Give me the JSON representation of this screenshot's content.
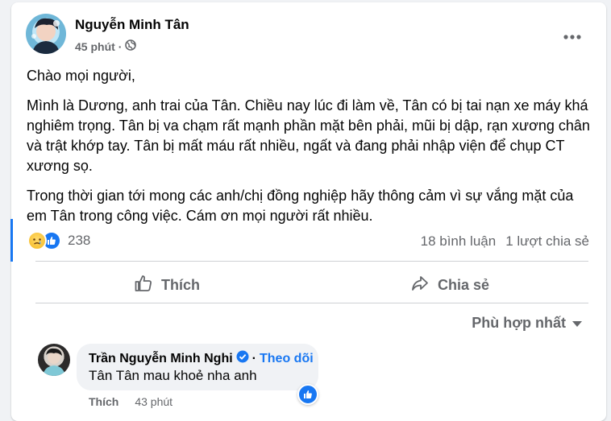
{
  "post": {
    "author": "Nguyễn Minh Tân",
    "time": "45 phút",
    "separator": "·",
    "paragraphs": [
      "Chào mọi người,",
      "Mình là Dương, anh trai của Tân. Chiều nay lúc đi làm về, Tân có bị tai nạn xe máy khá nghiêm trọng. Tân bị va chạm rất mạnh phần mặt bên phải, mũi bị dập, rạn xương chân và trật khớp tay. Tân bị mất máu rất nhiều, ngất và đang phải nhập viện để chụp CT xương sọ.",
      "Trong thời gian tới mong các anh/chị đồng nghiệp hãy thông cảm vì sự vắng mặt của em Tân trong công việc. Cám ơn mọi người rất nhiều."
    ],
    "reaction_count": "238",
    "comments_count": "18 bình luận",
    "shares_count": "1 lượt chia sẻ"
  },
  "actions": {
    "like_label": "Thích",
    "share_label": "Chia sẻ"
  },
  "comments_section": {
    "sort_label": "Phù hợp nhất"
  },
  "comment": {
    "author": "Trần Nguyễn Minh Nghi",
    "follow_label": "Theo dõi",
    "separator": "·",
    "text": "Tân Tân mau khoẻ nha anh",
    "like_label": "Thích",
    "time": "43 phút"
  },
  "colors": {
    "accent": "#1877f2",
    "secondary_text": "#65676b",
    "background": "#f0f2f5"
  },
  "icons": [
    "more-horizontal-icon",
    "globe-icon",
    "sad-reaction-icon",
    "like-reaction-icon",
    "thumbs-up-icon",
    "share-arrow-icon",
    "caret-down-icon",
    "verified-badge-icon"
  ]
}
